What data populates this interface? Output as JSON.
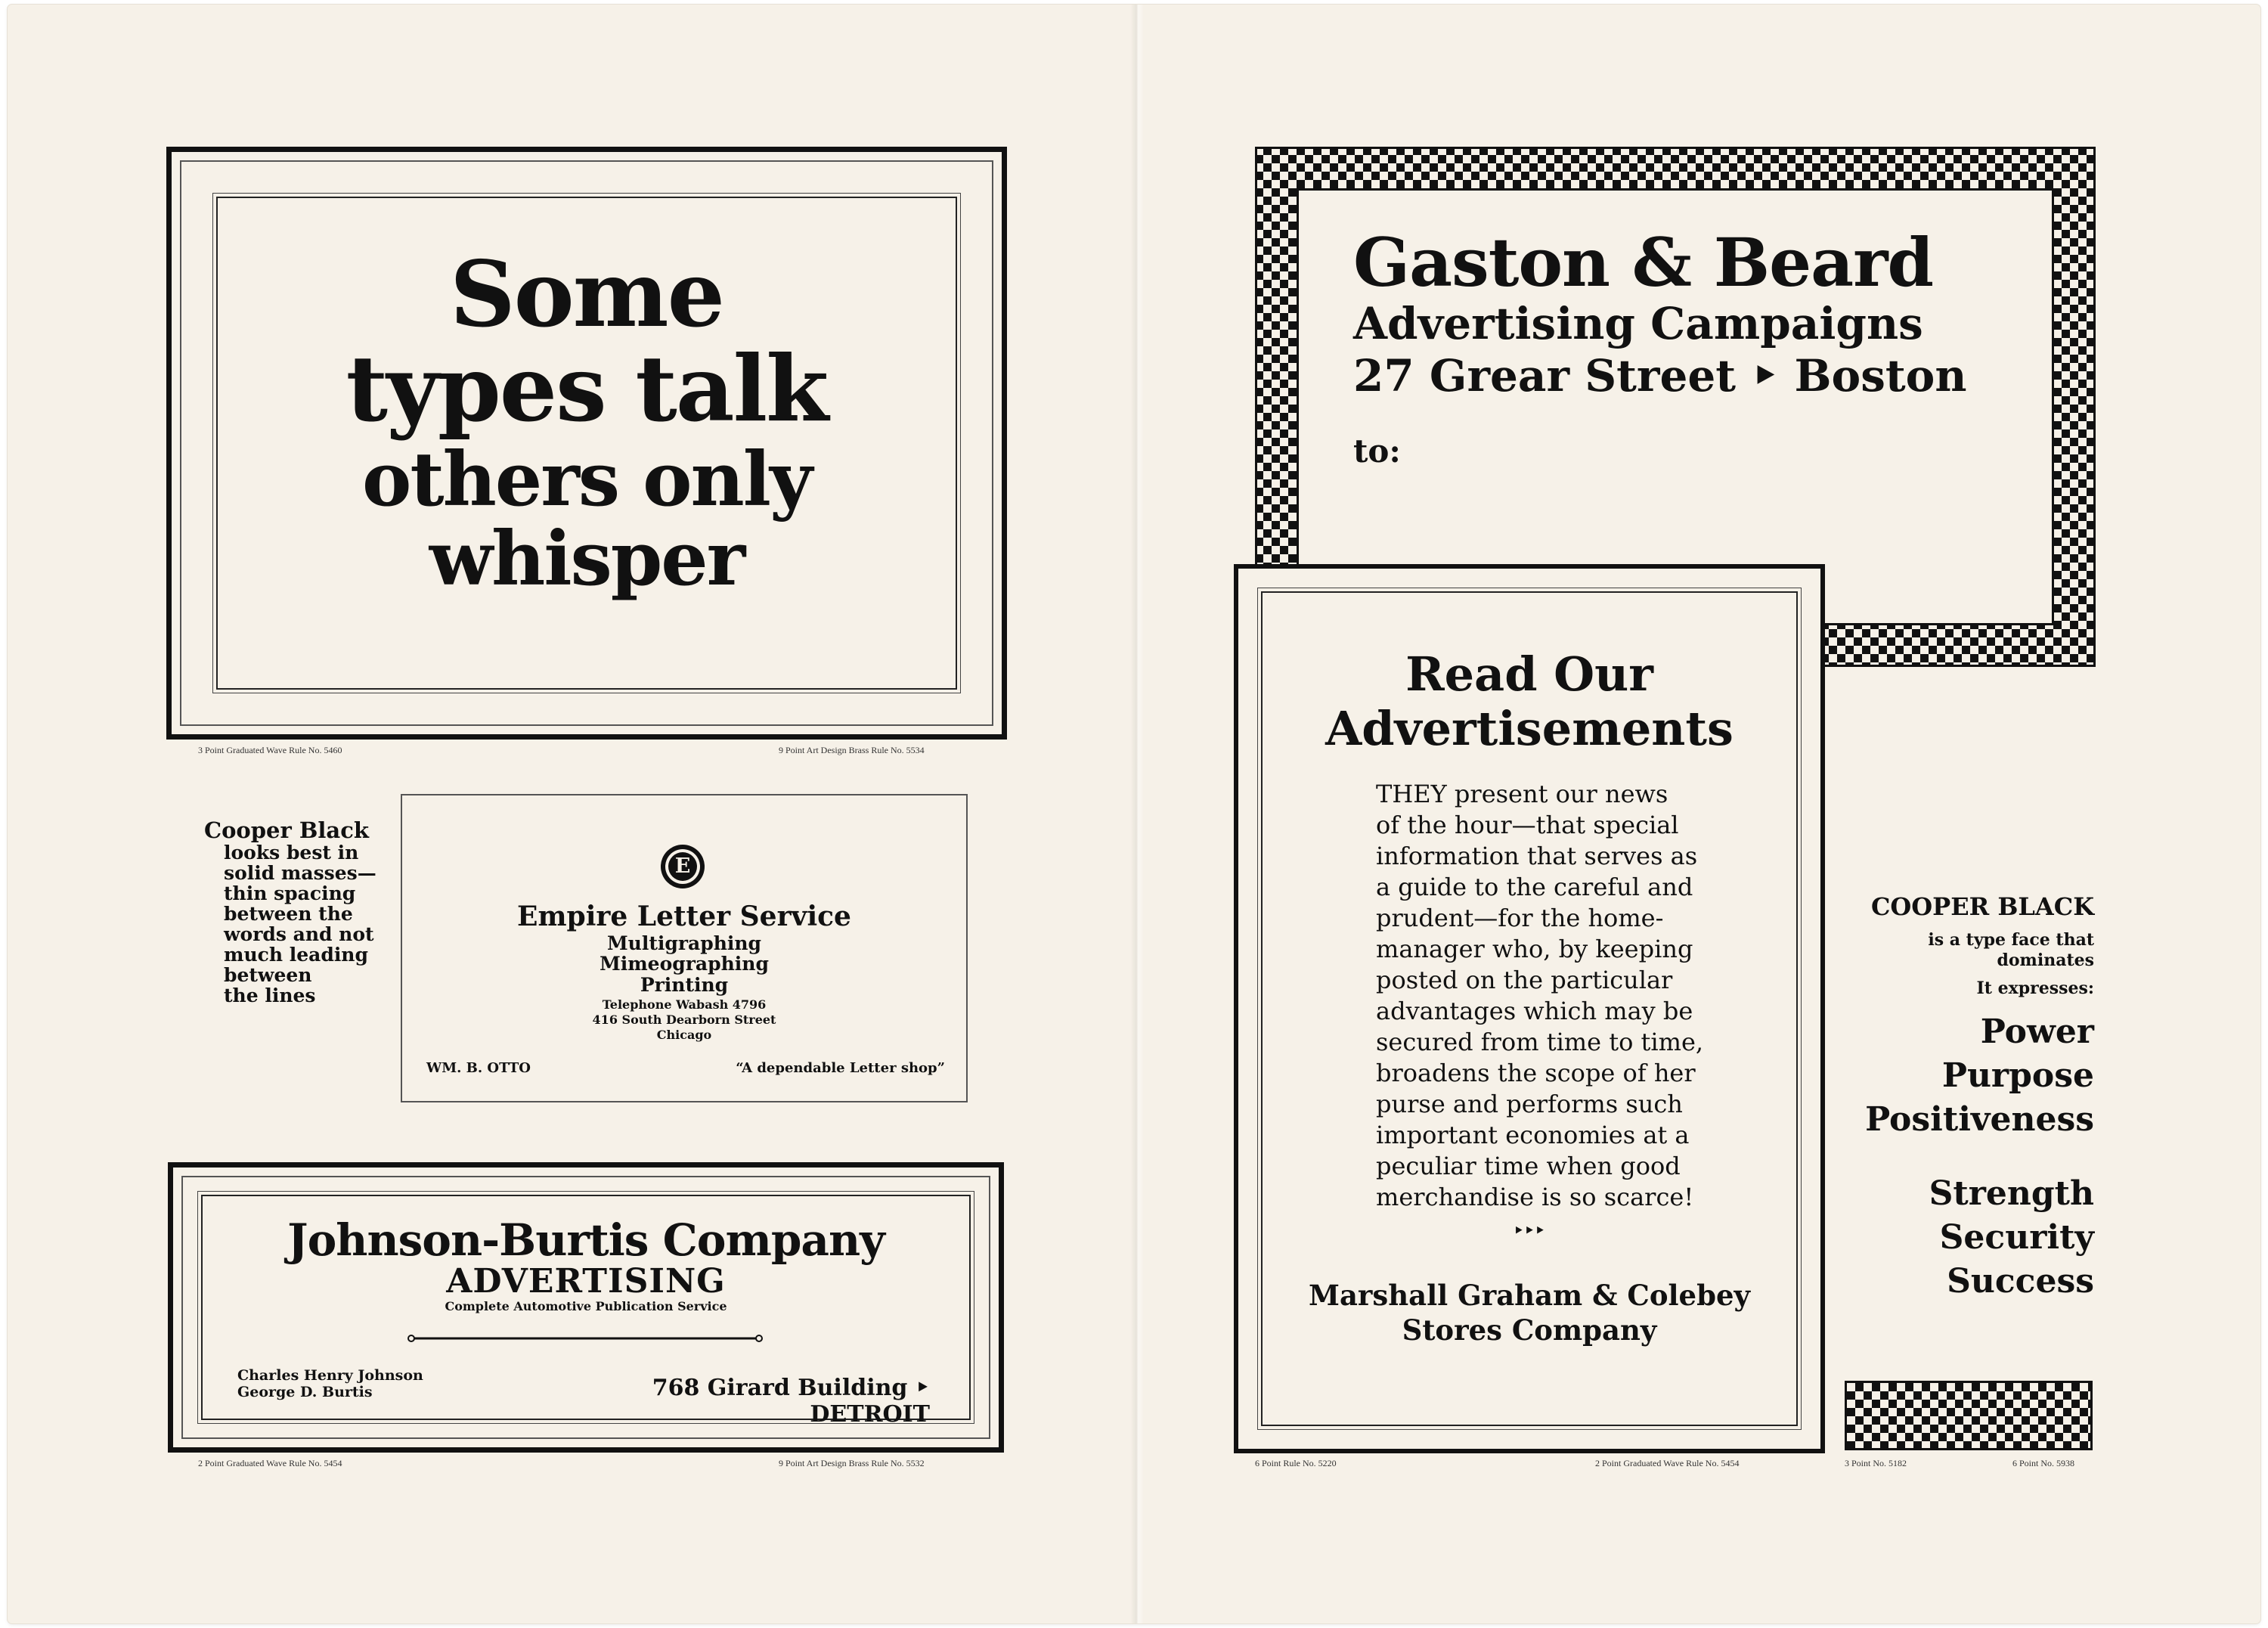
{
  "left_page": {
    "headline": {
      "line1": "Some",
      "line2": "types talk",
      "line3": "others only",
      "line4": "whisper"
    },
    "caption_top_left": "3 Point Graduated Wave Rule No. 5460",
    "caption_top_right": "9 Point Art Design Brass Rule No. 5534",
    "cooper_note": [
      "Cooper Black",
      "looks best in",
      "solid masses—",
      "thin spacing",
      "between the",
      "words and not",
      "much leading",
      "between",
      "the lines"
    ],
    "empire": {
      "emblem": "E",
      "name": "Empire Letter Service",
      "services": [
        "Multigraphing",
        "Mimeographing",
        "Printing"
      ],
      "phone": "Telephone Wabash 4796",
      "address": "416 South Dearborn Street",
      "city": "Chicago",
      "owner": "WM. B. OTTO",
      "slogan": "“A dependable Letter shop”"
    },
    "johnson": {
      "name": "Johnson-Burtis Company",
      "tagline": "ADVERTISING",
      "service": "Complete Automotive Publication Service",
      "person1": "Charles Henry Johnson",
      "person2": "George D. Burtis",
      "address": "768 Girard Building ‣ DETROIT"
    },
    "caption_bottom_left": "2 Point Graduated Wave Rule No. 5454",
    "caption_bottom_right": "9 Point Art Design Brass Rule No. 5532"
  },
  "right_page": {
    "gaston": {
      "name": "Gaston & Beard",
      "line2": "Advertising Campaigns",
      "line3": "27 Grear Street ‣ Boston",
      "to": "to:"
    },
    "read": {
      "title1": "Read Our",
      "title2": "Advertisements",
      "body": [
        "THEY present our news",
        "of the hour—that special",
        "information that serves as",
        "a guide to the careful and",
        "prudent—for the home-",
        "manager who, by keeping",
        "posted on the particular",
        "advantages which may be",
        "secured from time to time,",
        "broadens the scope of her",
        "purse and performs such",
        "important economies at a",
        "peculiar time when good",
        "merchandise is so scarce!"
      ],
      "ornament": "‣‣‣",
      "signature1": "Marshall Graham & Colebey",
      "signature2": "Stores Company"
    },
    "cooper": {
      "heading": "COOPER BLACK",
      "desc1": "is a type face that",
      "desc2": "dominates",
      "desc3": "It expresses:",
      "words1": [
        "Power",
        "Purpose",
        "Positiveness"
      ],
      "words2": [
        "Strength",
        "Security",
        "Success"
      ]
    },
    "caption_1": "6 Point Rule No. 5220",
    "caption_2": "2 Point Graduated Wave Rule No. 5454",
    "caption_3": "3 Point No. 5182",
    "caption_4": "6 Point No. 5938"
  }
}
